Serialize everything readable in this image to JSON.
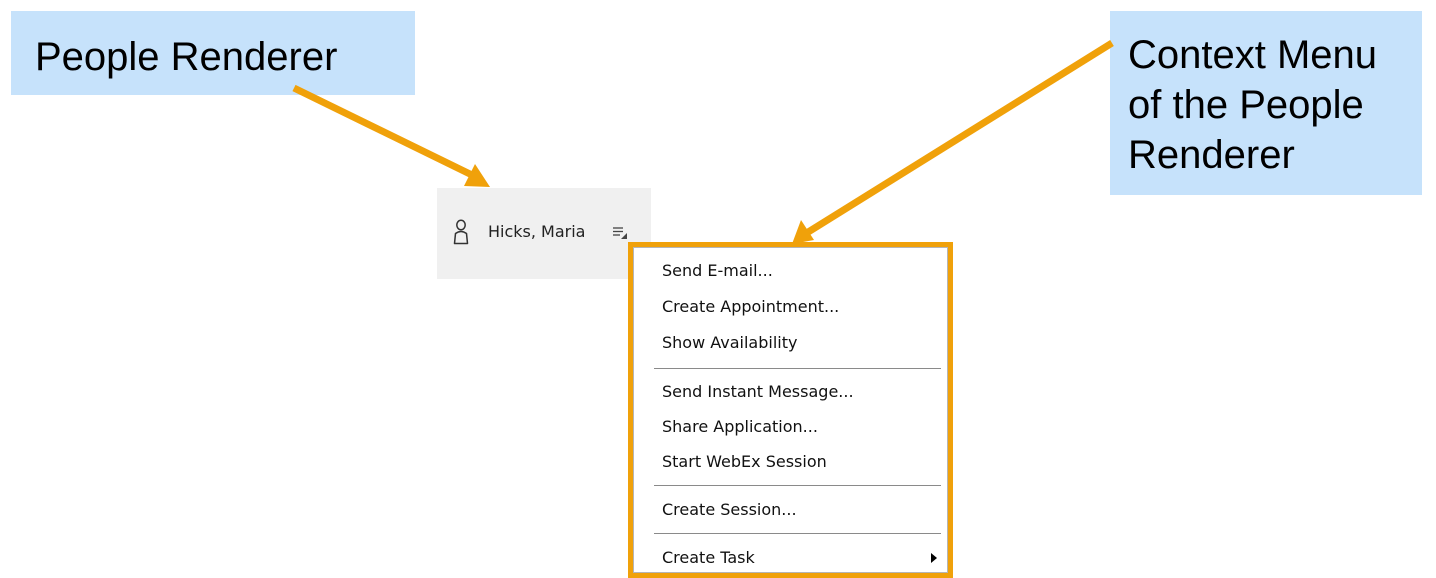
{
  "callouts": {
    "people_renderer": "People Renderer",
    "context_menu_lines": [
      "Context Menu",
      "of the People",
      "Renderer"
    ]
  },
  "renderer": {
    "person_name": "Hicks, Maria",
    "icon": "person-icon",
    "menu_icon": "context-menu-icon"
  },
  "menu": {
    "items": [
      {
        "label": "Send E-mail..."
      },
      {
        "label": "Create Appointment..."
      },
      {
        "label": "Show Availability"
      },
      {
        "label": "Send Instant Message..."
      },
      {
        "label": "Share Application..."
      },
      {
        "label": "Start WebEx Session"
      },
      {
        "label": "Create Session..."
      },
      {
        "label": "Create Task",
        "submenu": true
      }
    ]
  },
  "colors": {
    "callout_bg": "#c6e2fb",
    "highlight_orange": "#f0a10a",
    "renderer_bg": "#f0f0f0"
  }
}
